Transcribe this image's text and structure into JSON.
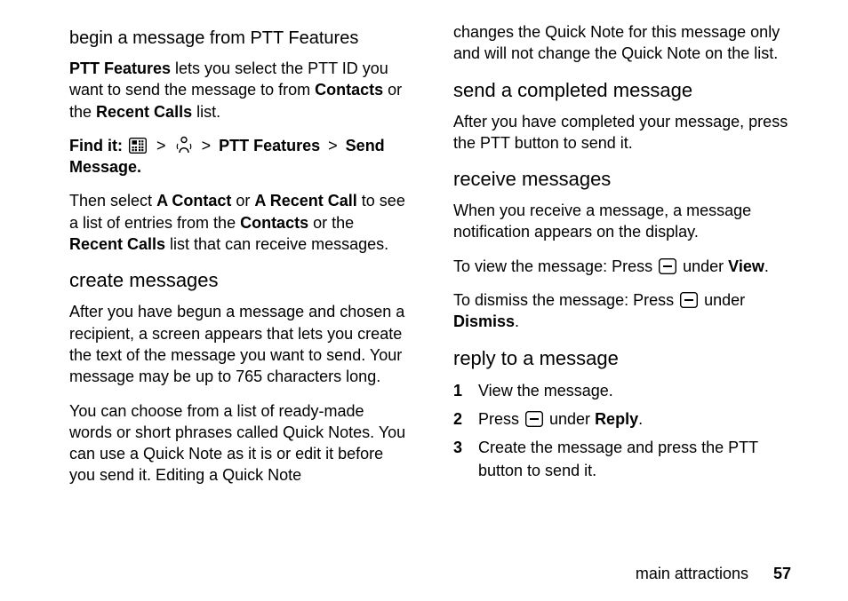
{
  "left": {
    "h_sub": "begin a message from PTT Features",
    "p1_a": "PTT Features",
    "p1_b": " lets you select the PTT ID you want to send the message to from ",
    "p1_c": "Contacts",
    "p1_d": " or the ",
    "p1_e": "Recent Calls",
    "p1_f": " list.",
    "findit_label": "Find it:",
    "findit_a": "PTT Features",
    "findit_b": "Send Message.",
    "gt": ">",
    "p2_a": "Then select ",
    "p2_b": "A Contact",
    "p2_c": " or ",
    "p2_d": "A Recent Call",
    "p2_e": " to see a list of entries from the ",
    "p2_f": "Contacts",
    "p2_g": " or the ",
    "p2_h": "Recent Calls",
    "p2_i": " list that can receive messages.",
    "h_sec": "create messages",
    "p3": "After you have begun a message and chosen a recipient, a screen appears that lets you create the text of the message you want to send. Your message may be up to 765 characters long.",
    "p4": "You can choose from a list of ready-made words or short phrases called Quick Notes. You can use a Quick Note as it is or edit it before you send it. Editing a Quick Note"
  },
  "right": {
    "p0": "changes the Quick Note for this message only and will not change the Quick Note on the list.",
    "h1": "send a completed message",
    "p1": "After you have completed your message, press the PTT button to send it.",
    "h2": "receive messages",
    "p2": "When you receive a message, a message notification appears on the display.",
    "p3_a": "To view the message: Press ",
    "p3_b": " under ",
    "p3_c": "View",
    "p3_d": ".",
    "p4_a": "To dismiss the message: Press ",
    "p4_b": " under ",
    "p4_c": "Dismiss",
    "p4_d": ".",
    "h3": "reply to a message",
    "step1": "View the message.",
    "step2_a": "Press ",
    "step2_b": " under ",
    "step2_c": "Reply",
    "step2_d": ".",
    "step3": "Create the message and press the PTT button to send it.",
    "n1": "1",
    "n2": "2",
    "n3": "3"
  },
  "footer": {
    "section": "main attractions",
    "page": "57"
  }
}
